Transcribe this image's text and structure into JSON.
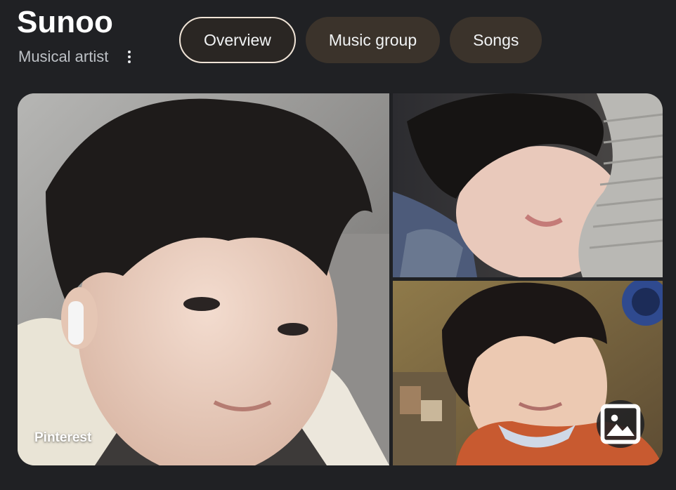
{
  "header": {
    "title": "Sunoo",
    "subtitle": "Musical artist",
    "more_icon": "more-vert-icon"
  },
  "tabs": [
    {
      "label": "Overview",
      "active": true
    },
    {
      "label": "Music group",
      "active": false
    },
    {
      "label": "Songs",
      "active": false
    }
  ],
  "gallery": {
    "main_image": {
      "alt": "Sunoo",
      "source": "Pinterest"
    },
    "top_right_image": {
      "alt": "Sunoo"
    },
    "bottom_right_image": {
      "alt": "Sunoo"
    },
    "images_button_icon": "image-icon"
  },
  "colors": {
    "background": "#202124",
    "tab_background": "#3b332b",
    "active_tab_border": "#efe3d6",
    "text_primary": "#ffffff",
    "text_secondary": "#bdc1c6"
  }
}
